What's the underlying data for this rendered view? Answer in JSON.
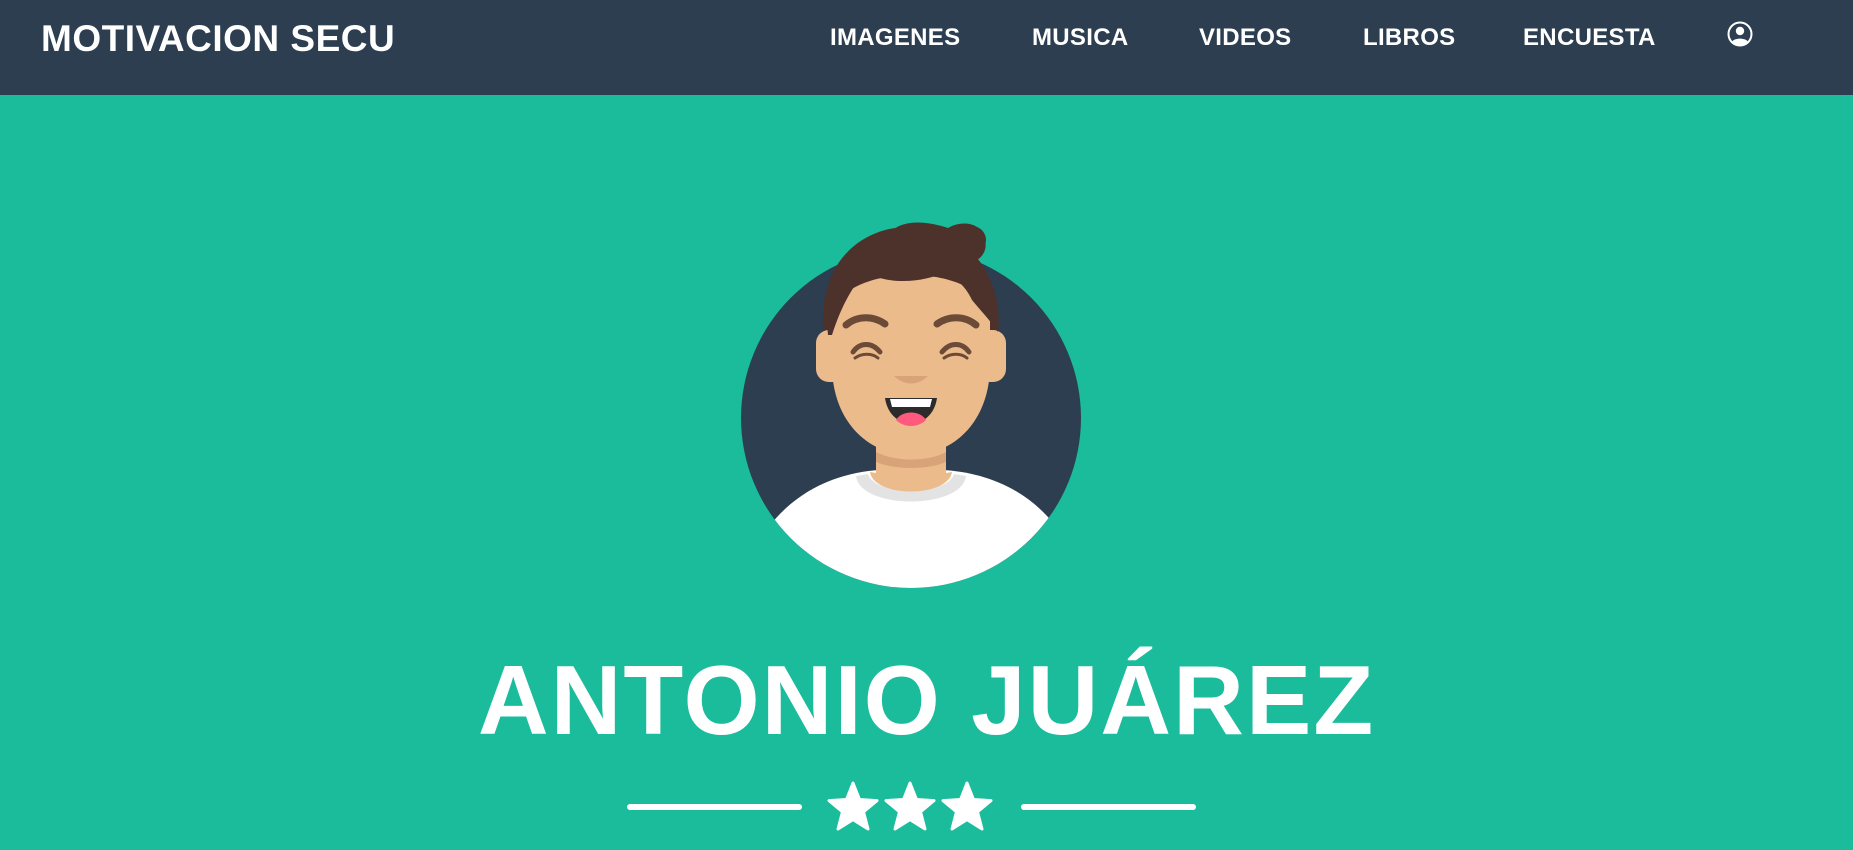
{
  "navbar": {
    "brand": "MOTIVACION SECU",
    "links": [
      {
        "label": "IMAGENES"
      },
      {
        "label": "MUSICA"
      },
      {
        "label": "VIDEOS"
      },
      {
        "label": "LIBROS"
      },
      {
        "label": "ENCUESTA"
      }
    ],
    "user_icon": "user-circle-icon"
  },
  "masthead": {
    "avatar_icon": "avatar-illustration",
    "name": "ANTONIO JUÁREZ",
    "divider_icon": "star-icon",
    "divider_star_count": 3
  },
  "colors": {
    "navbar_bg": "#2c3e50",
    "masthead_bg": "#1abc9c",
    "text": "#ffffff"
  }
}
